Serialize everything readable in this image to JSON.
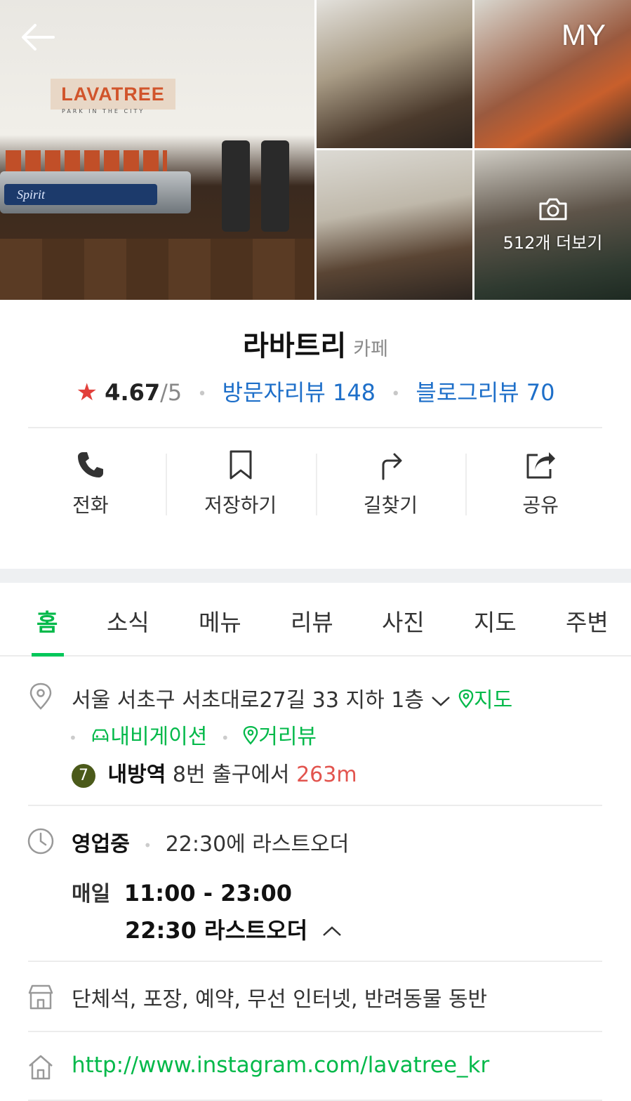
{
  "header": {
    "back_icon": "arrow-left-icon",
    "my_label": "MY",
    "photos": {
      "main_sign": "LAVATREE",
      "main_sign_sub": "PARK IN THE CITY",
      "machine_label": "Spirit",
      "more_label": "512개 더보기",
      "more_icon": "camera-icon"
    }
  },
  "place": {
    "name": "라바트리",
    "category": "카페",
    "rating_value": "4.67",
    "rating_max": "/5",
    "visitor_reviews": "방문자리뷰 148",
    "blog_reviews": "블로그리뷰 70"
  },
  "actions": [
    {
      "label": "전화",
      "icon": "phone-icon"
    },
    {
      "label": "저장하기",
      "icon": "bookmark-icon"
    },
    {
      "label": "길찾기",
      "icon": "directions-icon"
    },
    {
      "label": "공유",
      "icon": "share-icon"
    }
  ],
  "tabs": [
    {
      "label": "홈",
      "active": true
    },
    {
      "label": "소식"
    },
    {
      "label": "메뉴"
    },
    {
      "label": "리뷰"
    },
    {
      "label": "사진"
    },
    {
      "label": "지도"
    },
    {
      "label": "주변"
    }
  ],
  "address": {
    "text": "서울 서초구 서초대로27길 33 지하 1층",
    "map_link": "지도",
    "navigation_link": "내비게이션",
    "street_view_link": "거리뷰",
    "subway_line": "7",
    "station": "내방역",
    "exit_text": "8번 출구에서",
    "distance": "263m"
  },
  "hours": {
    "status": "영업중",
    "last_order_summary": "22:30에 라스트오더",
    "day": "매일",
    "time_range": "11:00 - 23:00",
    "last_order_detail": "22:30 라스트오더"
  },
  "amenities": "단체석, 포장, 예약, 무선 인터넷, 반려동물 동반",
  "website": "http://www.instagram.com/lavatree_kr",
  "colors": {
    "accent_green": "#03c75a",
    "link_blue": "#1e6fc9",
    "star_red": "#e2403b",
    "distance_red": "#e2544e",
    "line7_badge": "#4b5a1a"
  }
}
